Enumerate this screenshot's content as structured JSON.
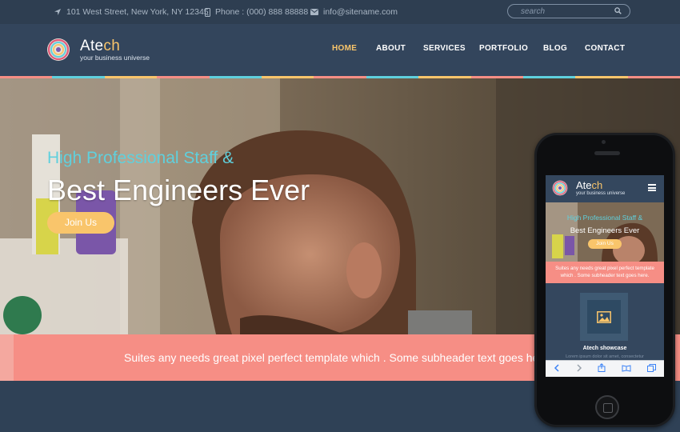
{
  "topbar": {
    "address": "101 West Street, New York, NY 12345",
    "phone": "Phone : (000) 888 88888",
    "email": "info@sitename.com",
    "search_placeholder": "search"
  },
  "brand": {
    "name_main": "Ate",
    "name_accent": "ch",
    "tagline": "your business universe"
  },
  "nav": {
    "items": [
      "HOME",
      "ABOUT",
      "SERVICES",
      "PORTFOLIO",
      "BLOG",
      "CONTACT"
    ],
    "active": "HOME"
  },
  "hero": {
    "subtitle": "High Professional Staff &",
    "title": "Best Engineers Ever",
    "button": "Join Us"
  },
  "band": {
    "text": "Suites any needs great pixel perfect template which . Some subheader text goes he"
  },
  "mobile": {
    "name_main": "Ate",
    "name_accent": "ch",
    "tagline": "your business universe",
    "hero_subtitle": "High Professional Staff &",
    "hero_title": "Best Engineers Ever",
    "button": "Join Us",
    "band_text": "Suites any needs great pixel perfect template which . Some subheader text goes here.",
    "showcase_title": "Atech showcase",
    "showcase_text": "Lorem ipsum dolor sit amet, consectetur"
  },
  "colors": {
    "accent_yellow": "#f9c56b",
    "accent_cyan": "#5fd0dd",
    "band_coral": "#f68e85",
    "header_navy": "#33455c"
  },
  "icons": {
    "address": "location-arrow-icon",
    "phone": "mobile-phone-icon",
    "email": "envelope-icon",
    "search": "search-icon",
    "menu": "hamburger-menu-icon"
  }
}
